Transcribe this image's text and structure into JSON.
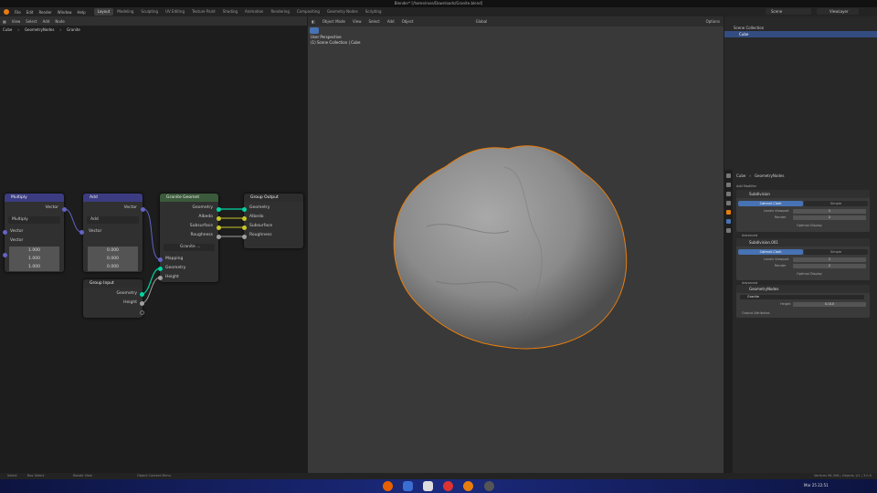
{
  "window": {
    "title": "Blender* [/home/rose/Downloads/Granite.blend]"
  },
  "menu": {
    "items": [
      "File",
      "Edit",
      "Render",
      "Window",
      "Help"
    ],
    "workspaces": [
      "Layout",
      "Modeling",
      "Sculpting",
      "UV Editing",
      "Texture Paint",
      "Shading",
      "Animation",
      "Rendering",
      "Compositing",
      "Geometry Nodes",
      "Scripting"
    ],
    "active_workspace": "Layout",
    "scene": "Scene",
    "view_layer": "ViewLayer"
  },
  "node_editor": {
    "header": [
      "View",
      "Select",
      "Add",
      "Node"
    ],
    "breadcrumb": [
      "Cube",
      "GeometryNodes",
      "Granite"
    ],
    "nodes": {
      "multiply": {
        "title": "Multiply",
        "output": "Vector",
        "mode": "Multiply",
        "in1": "Vector",
        "in2": "Vector",
        "values": [
          "1.000",
          "1.000",
          "1.000"
        ]
      },
      "add": {
        "title": "Add",
        "output": "Vector",
        "mode": "Add",
        "in1": "Vector",
        "values": [
          "0.000",
          "0.000",
          "0.000"
        ]
      },
      "granite": {
        "title": "Granite Geomet",
        "outputs": [
          "Geometry",
          "Albedo",
          "Subsurface",
          "Roughness"
        ],
        "group": "Granite ...",
        "inputs": [
          "Mapping",
          "Geometry",
          "Height"
        ]
      },
      "group_output": {
        "title": "Group Output",
        "inputs": [
          "Geometry",
          "Albedo",
          "Subsurface",
          "Roughness"
        ]
      },
      "group_input": {
        "title": "Group Input",
        "outputs": [
          "Geometry",
          "Height"
        ]
      }
    }
  },
  "viewport": {
    "mode": "Object Mode",
    "menus": [
      "View",
      "Select",
      "Add",
      "Object"
    ],
    "shading": "Global",
    "options": "Options",
    "overlay_title": "User Perspective",
    "overlay_subtitle": "(1) Scene Collection | Cube"
  },
  "outliner": {
    "rows": [
      "Scene Collection",
      "Cube"
    ]
  },
  "properties": {
    "breadcrumb": [
      "Cube",
      "GeometryNodes"
    ],
    "add_modifier": "Add Modifier",
    "modifiers": [
      {
        "name": "Subdivision",
        "tabs": [
          "Catmull-Clark",
          "Simple"
        ],
        "fields": [
          {
            "label": "Levels Viewport",
            "value": "1"
          },
          {
            "label": "Render",
            "value": "2"
          }
        ],
        "option": "Optimal Display"
      },
      {
        "name": "Subdivision.001",
        "tabs": [
          "Catmull-Clark",
          "Simple"
        ],
        "fields": [
          {
            "label": "Levels Viewport",
            "value": "1"
          },
          {
            "label": "Render",
            "value": "2"
          }
        ],
        "option": "Optimal Display"
      },
      {
        "name": "GeometryNodes",
        "node_group": "Granite",
        "fields": [
          {
            "label": "Height",
            "value": "0.010"
          }
        ],
        "footer": "Output Attributes"
      }
    ],
    "section_advanced": "Advanced"
  },
  "status": {
    "left": [
      "Select",
      "Box Select",
      "Rotate View",
      "Object Context Menu"
    ],
    "right": "Vertices 98,306 | Objects 1/1 | 3.0.0"
  },
  "taskbar": {
    "clock": "Mar 25  22:51"
  },
  "colors": {
    "accent": "#4772b3",
    "vector_node": "#3c3c83",
    "group_node": "#3b5a3b",
    "object_orange": "#e87d0d"
  }
}
